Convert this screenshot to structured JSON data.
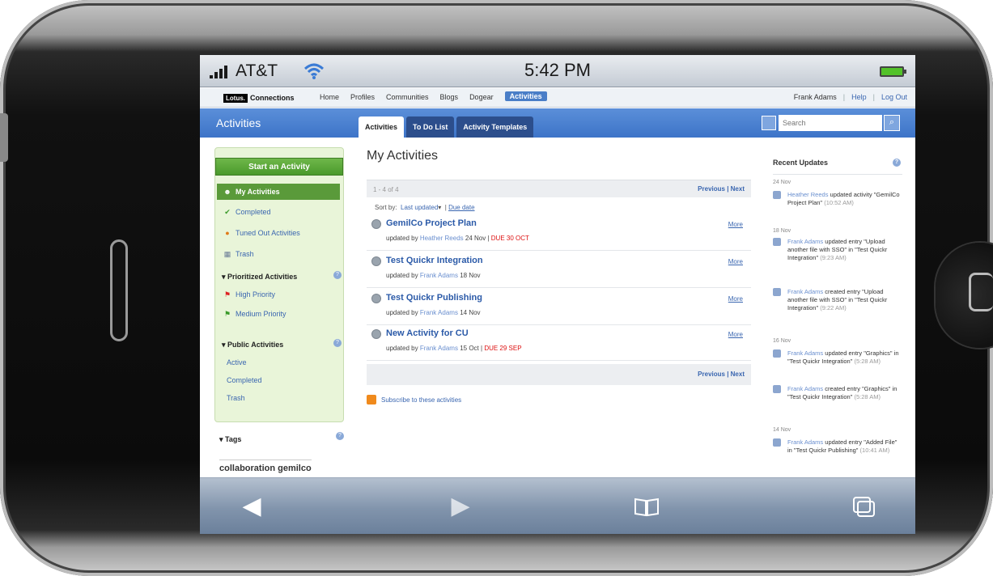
{
  "status_bar": {
    "carrier": "AT&T",
    "time": "5:42 PM"
  },
  "top_nav": {
    "logo_box": "Lotus.",
    "logo_text": "Connections",
    "items": [
      "Home",
      "Profiles",
      "Communities",
      "Blogs",
      "Dogear",
      "Activities"
    ],
    "user": "Frank Adams",
    "help": "Help",
    "logout": "Log Out"
  },
  "header": {
    "title": "Activities",
    "tabs": [
      "Activities",
      "To Do List",
      "Activity Templates"
    ],
    "search_placeholder": "Search"
  },
  "sidebar": {
    "start_button": "Start an Activity",
    "items": [
      {
        "label": "My Activities",
        "icon": "people-icon"
      },
      {
        "label": "Completed",
        "icon": "checkmark-icon"
      },
      {
        "label": "Tuned Out Activities",
        "icon": "tuned-out-icon"
      },
      {
        "label": "Trash",
        "icon": "trash-icon"
      }
    ],
    "prioritized_title": "Prioritized Activities",
    "prioritized_items": [
      {
        "label": "High Priority",
        "icon": "red-flag-icon"
      },
      {
        "label": "Medium Priority",
        "icon": "green-flag-icon"
      }
    ],
    "public_title": "Public Activities",
    "public_items": [
      "Active",
      "Completed",
      "Trash"
    ],
    "tags_title": "Tags",
    "tags": [
      "collaboration",
      "gemilco"
    ]
  },
  "main": {
    "title": "My Activities",
    "pager_count": "1 - 4 of 4",
    "previous": "Previous",
    "next": "Next",
    "sort_label": "Sort by:",
    "sort_active": "Last updated",
    "sort_other": "Due date",
    "more_label": "More",
    "activities": [
      {
        "title": "GemilCo Project Plan",
        "prefix": "updated by",
        "who": "Heather Reeds",
        "when": "24 Nov |",
        "due": "DUE 30 OCT"
      },
      {
        "title": "Test Quickr Integration",
        "prefix": "updated by",
        "who": "Frank Adams",
        "when": "18 Nov",
        "due": ""
      },
      {
        "title": "Test Quickr Publishing",
        "prefix": "updated by",
        "who": "Frank Adams",
        "when": "14 Nov",
        "due": ""
      },
      {
        "title": "New Activity for CU",
        "prefix": "updated by",
        "who": "Frank Adams",
        "when": "15 Oct |",
        "due": "DUE 29 SEP"
      }
    ],
    "subscribe": "Subscribe to these activities"
  },
  "recent": {
    "title": "Recent Updates",
    "d1": "24 Nov",
    "e1_who": "Heather Reeds",
    "e1_text": "updated activity \"GemilCo Project Plan\"",
    "e1_time": "(10:52 AM)",
    "d2": "18 Nov",
    "e2_who": "Frank Adams",
    "e2_text": "updated entry \"Upload another file with SSO\" in \"Test Quickr Integration\"",
    "e2_time": "(9:23 AM)",
    "e3_who": "Frank Adams",
    "e3_text": "created entry \"Upload another file with SSO\" in \"Test Quickr Integration\"",
    "e3_time": "(9:22 AM)",
    "d3": "16 Nov",
    "e4_who": "Frank Adams",
    "e4_text": "updated entry \"Graphics\" in \"Test Quickr Integration\"",
    "e4_time": "(5:28 AM)",
    "e5_who": "Frank Adams",
    "e5_text": "created entry \"Graphics\" in \"Test Quickr Integration\"",
    "e5_time": "(5:28 AM)",
    "d4": "14 Nov",
    "e6_who": "Frank Adams",
    "e6_text": "updated entry \"Added File\" in \"Test Quickr Publishing\"",
    "e6_time": "(10:41 AM)"
  },
  "toolbar": {
    "icons": [
      "back-arrow-icon",
      "forward-arrow-icon",
      "bookmarks-icon",
      "pages-icon"
    ]
  }
}
